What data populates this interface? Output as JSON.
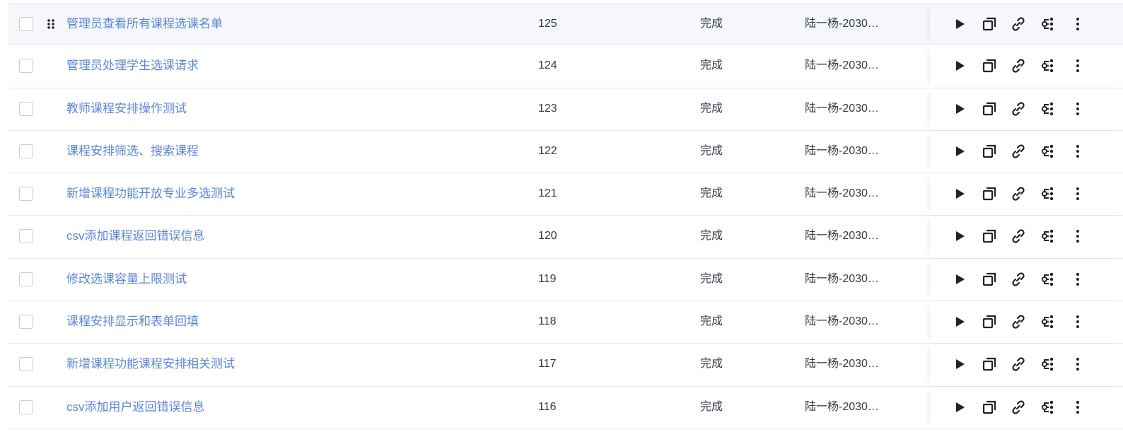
{
  "table": {
    "rows": [
      {
        "name": "管理员查看所有课程选课名单",
        "id": "125",
        "status": "完成",
        "owner": "陆一杨-2030…"
      },
      {
        "name": "管理员处理学生选课请求",
        "id": "124",
        "status": "完成",
        "owner": "陆一杨-2030…"
      },
      {
        "name": "教师课程安排操作测试",
        "id": "123",
        "status": "完成",
        "owner": "陆一杨-2030…"
      },
      {
        "name": "课程安排筛选、搜索课程",
        "id": "122",
        "status": "完成",
        "owner": "陆一杨-2030…"
      },
      {
        "name": "新增课程功能开放专业多选测试",
        "id": "121",
        "status": "完成",
        "owner": "陆一杨-2030…"
      },
      {
        "name": "csv添加课程返回错误信息",
        "id": "120",
        "status": "完成",
        "owner": "陆一杨-2030…"
      },
      {
        "name": "修改选课容量上限测试",
        "id": "119",
        "status": "完成",
        "owner": "陆一杨-2030…"
      },
      {
        "name": "课程安排显示和表单回填",
        "id": "118",
        "status": "完成",
        "owner": "陆一杨-2030…"
      },
      {
        "name": "新增课程功能课程安排相关测试",
        "id": "117",
        "status": "完成",
        "owner": "陆一杨-2030…"
      },
      {
        "name": "csv添加用户返回错误信息",
        "id": "116",
        "status": "完成",
        "owner": "陆一杨-2030…"
      }
    ],
    "hovered_row_index": 0
  },
  "icons": {
    "row_actions": [
      "play-icon",
      "copy-icon",
      "link-icon",
      "flow-icon",
      "more-vertical-icon"
    ],
    "drag": "drag-handle-icon"
  },
  "colors": {
    "link": "#5b86d6",
    "text": "#333a45",
    "border": "#e6e8eb",
    "hover_bg": "#f5f7fb"
  }
}
